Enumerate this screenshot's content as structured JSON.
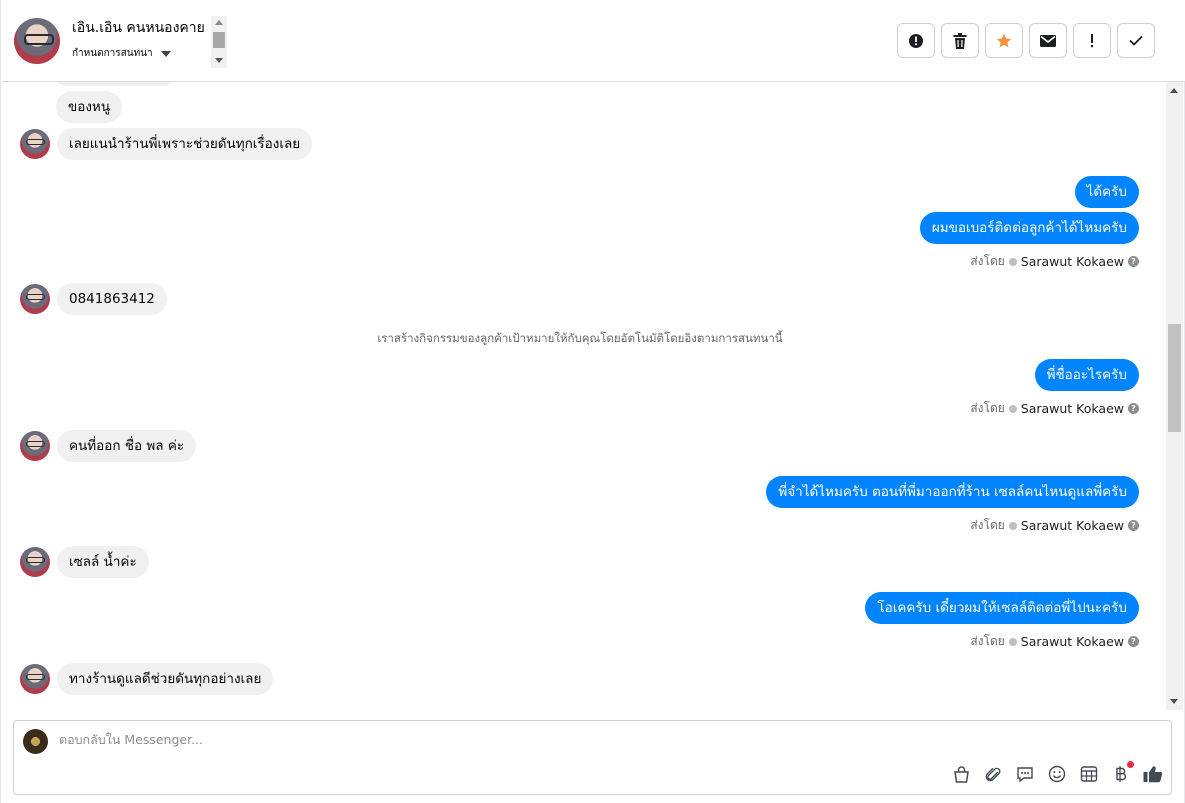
{
  "header": {
    "contact_name": "เอิน.เอิน คนหนองคาย",
    "status_label": "กำหนดการสนทนา",
    "actions": [
      {
        "name": "mark-spam-button",
        "icon": "alert-circle-icon"
      },
      {
        "name": "delete-button",
        "icon": "trash-icon"
      },
      {
        "name": "star-button",
        "icon": "star-icon"
      },
      {
        "name": "mark-unread-button",
        "icon": "envelope-icon"
      },
      {
        "name": "follow-up-button",
        "icon": "exclamation-icon"
      },
      {
        "name": "mark-done-button",
        "icon": "check-icon"
      }
    ],
    "star_color": "#f7923a"
  },
  "conversation": {
    "partial_top": "ของหนู",
    "messages": [
      {
        "dir": "in",
        "text": "เลยแนนำร้านพี่เพราะช่วยดันทุกเรื่องเลย"
      },
      {
        "dir": "out",
        "text": "ได้ครับ"
      },
      {
        "dir": "out",
        "text": "ผมขอเบอร์ติดต่อลูกค้าได้ไหมครับ"
      },
      {
        "dir": "in",
        "text": "0841863412"
      },
      {
        "dir": "out",
        "text": "พี่ชื่ออะไรครับ"
      },
      {
        "dir": "in",
        "text": "คนที่ออก ชื่อ พล ค่ะ"
      },
      {
        "dir": "out",
        "text": "พี่จำได้ไหมครับ ตอนที่พี่มาออกที่ร้าน เซลล์คนไหนดูแลพี่ครับ"
      },
      {
        "dir": "in",
        "text": "เซลล์ น้ำค่ะ"
      },
      {
        "dir": "out",
        "text": "โอเคครับ เดี๋ยวผมให้เซลล์ติดต่อพี่ไปนะครับ"
      },
      {
        "dir": "in",
        "text": "ทางร้านดูแลดีช่วยดันทุกอย่างเลย"
      }
    ],
    "sent_by_label": "ส่งโดย",
    "sender_name": "Sarawut Kokaew",
    "system_note": "เราสร้างกิจกรรมของลูกค้าเป้าหมายให้กับคุณโดยอัตโนมัติโดยอิงตามการสนทนานี้",
    "outgoing_color": "#0084ff",
    "incoming_color": "#f0f0f0"
  },
  "composer": {
    "placeholder": "ตอบกลับใน Messenger...",
    "value": "",
    "tools": [
      "shopping-bag-icon",
      "paperclip-icon",
      "saved-reply-icon",
      "emoji-icon",
      "appointment-icon",
      "payment-icon",
      "thumbs-up-icon"
    ]
  }
}
